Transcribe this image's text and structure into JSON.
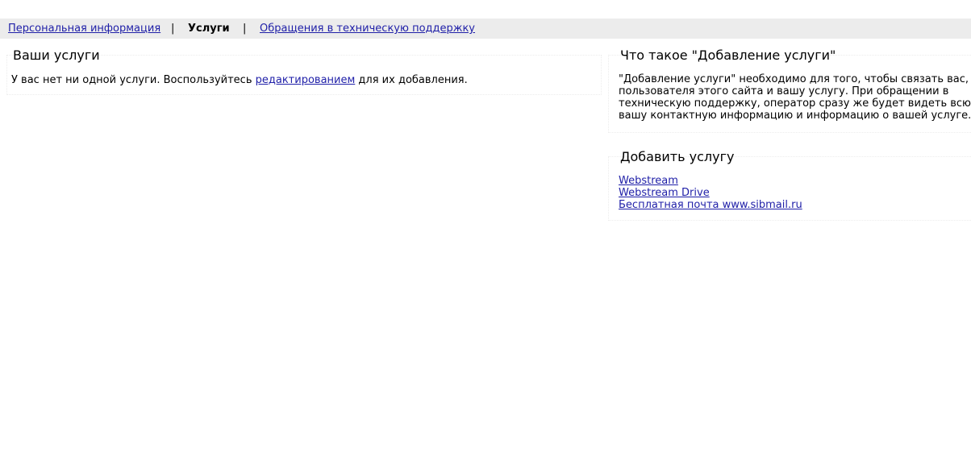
{
  "nav": {
    "personal_info": "Персональная информация",
    "separator": "|",
    "services": "Услуги",
    "support_tickets": "Обращения в техническую поддержку"
  },
  "your_services": {
    "title": "Ваши услуги",
    "text_before": "У вас нет ни одной услуги. Воспользуйтесь ",
    "link": "редактированием",
    "text_after": " для их добавления."
  },
  "what_is": {
    "title": "Что такое \"Добавление услуги\"",
    "lines": [
      "\"Добавление услуги\" необходимо для того, чтобы связать вас,",
      "пользователя этого сайта и вашу услугу. При обращении в",
      "техническую поддержку, оператор сразу же будет видеть всю",
      "вашу контактную информацию и информацию о вашей услуге."
    ]
  },
  "add_service": {
    "title": "Добавить услугу",
    "links": [
      "Webstream",
      "Webstream Drive",
      "Бесплатная почта www.sibmail.ru"
    ]
  },
  "colors": {
    "link": "#1f1fa8",
    "topbar_bg": "#ececec"
  }
}
